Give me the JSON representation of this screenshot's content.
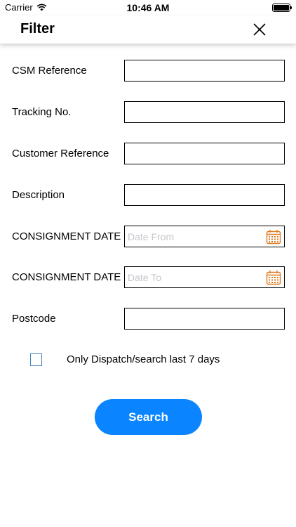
{
  "status_bar": {
    "carrier": "Carrier",
    "time": "10:46 AM"
  },
  "nav": {
    "title": "Filter"
  },
  "fields": [
    {
      "label": "CSM Reference",
      "value": "",
      "placeholder": ""
    },
    {
      "label": "Tracking No.",
      "value": "",
      "placeholder": ""
    },
    {
      "label": "Customer Reference",
      "value": "",
      "placeholder": ""
    },
    {
      "label": "Description",
      "value": "",
      "placeholder": ""
    },
    {
      "label": "CONSIGNMENT DATE",
      "value": "",
      "placeholder": "Date From",
      "icon": "calendar-icon"
    },
    {
      "label": "CONSIGNMENT DATE",
      "value": "",
      "placeholder": "Date To",
      "icon": "calendar-icon"
    },
    {
      "label": "Postcode",
      "value": "",
      "placeholder": ""
    }
  ],
  "checkbox": {
    "label": "Only Dispatch/search last 7 days",
    "checked": false
  },
  "search_button": {
    "label": "Search"
  },
  "colors": {
    "accent": "#0a84ff",
    "calendar": "#e07b22",
    "checkbox_border": "#3d86c6"
  }
}
